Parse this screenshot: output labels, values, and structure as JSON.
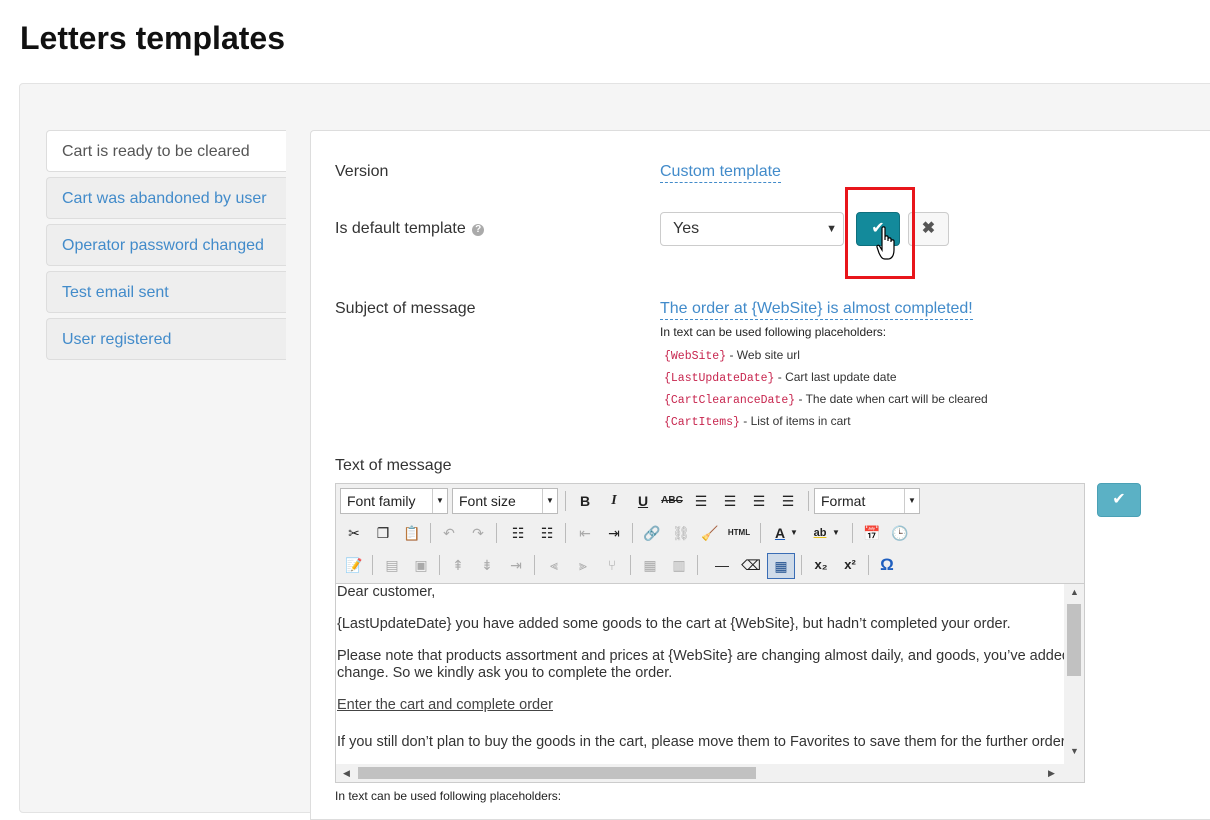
{
  "page": {
    "title": "Letters templates"
  },
  "tabs": [
    {
      "label": "Cart is ready to be cleared",
      "active": true
    },
    {
      "label": "Cart was abandoned by user",
      "active": false
    },
    {
      "label": "Operator password changed",
      "active": false
    },
    {
      "label": "Test email sent",
      "active": false
    },
    {
      "label": "User registered",
      "active": false
    }
  ],
  "form": {
    "version_label": "Version",
    "version_value": "Custom template",
    "default_label": "Is default template",
    "default_value": "Yes",
    "subject_label": "Subject of message",
    "subject_value": "The order at {WebSite} is almost completed!",
    "placeholders_title": "In text can be used following placeholders:",
    "placeholders": [
      {
        "code": "{WebSite}",
        "desc": " - Web site url"
      },
      {
        "code": "{LastUpdateDate}",
        "desc": " - Cart last update date"
      },
      {
        "code": "{CartClearanceDate}",
        "desc": " - The date when cart will be cleared"
      },
      {
        "code": "{CartItems}",
        "desc": " - List of items in cart"
      }
    ],
    "text_label": "Text of message",
    "bottom_note": "In text can be used following placeholders:"
  },
  "editor": {
    "font_family": "Font family",
    "font_size": "Font size",
    "format": "Format",
    "content": {
      "p1": "Dear customer,",
      "p2": "{LastUpdateDate} you have added some goods to the cart at {WebSite}, but hadn’t completed your order.",
      "p3a": "Please note that products assortment and prices at {WebSite} are changing almost daily, and goods, you’ve added",
      "p3b": "change. So we kindly ask you to complete the order.",
      "link": "Enter the cart and complete order",
      "p4": "If you still don’t plan to buy the goods in the cart, please move them to Favorites to save them for the further order"
    }
  },
  "colors": {
    "accent": "#428bca",
    "confirm": "#138a9b",
    "highlight": "#e8151b"
  }
}
